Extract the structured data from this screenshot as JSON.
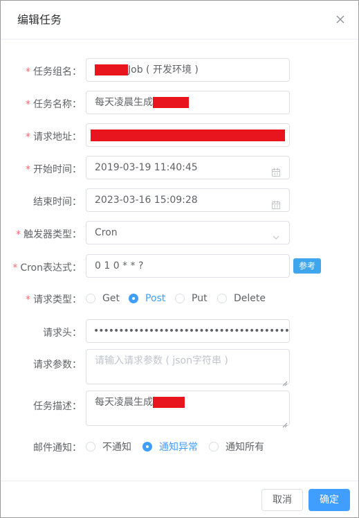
{
  "dialog": {
    "title": "编辑任务"
  },
  "form": {
    "group": {
      "label": "任务组名：",
      "value_suffix": "Job ( 开发环境 )"
    },
    "name": {
      "label": "任务名称：",
      "value_prefix": "每天凌晨生成"
    },
    "url": {
      "label": "请求地址："
    },
    "start": {
      "label": "开始时间：",
      "value": "2019-03-19 11:40:45"
    },
    "end": {
      "label": "结束时间：",
      "value": "2023-03-16 15:09:28"
    },
    "trigger": {
      "label": "触发器类型：",
      "value": "Cron"
    },
    "cron": {
      "label": "Cron表达式：",
      "value": "0 1 0 * * ?",
      "ref_button": "参考"
    },
    "method": {
      "label": "请求类型：",
      "options": [
        "Get",
        "Post",
        "Put",
        "Delete"
      ],
      "selected": "Post"
    },
    "headers": {
      "label": "请求头：",
      "value": "••••••••••••••••••••••••••••••••••••••••••"
    },
    "params": {
      "label": "请求参数：",
      "placeholder": "请输入请求参数 ( json字符串 )"
    },
    "desc": {
      "label": "任务描述：",
      "value_prefix": "每天凌晨生成"
    },
    "mail": {
      "label": "邮件通知：",
      "options": [
        "不通知",
        "通知异常",
        "通知所有"
      ],
      "selected": "通知异常"
    }
  },
  "footer": {
    "cancel": "取消",
    "confirm": "确定"
  },
  "icons": {
    "close": "close-icon",
    "calendar": "calendar-icon",
    "chevron": "chevron-down-icon"
  },
  "colors": {
    "primary": "#409eff",
    "required": "#f56c6c",
    "redaction": "#e8141e",
    "ref_button": "#3fa6ee"
  }
}
